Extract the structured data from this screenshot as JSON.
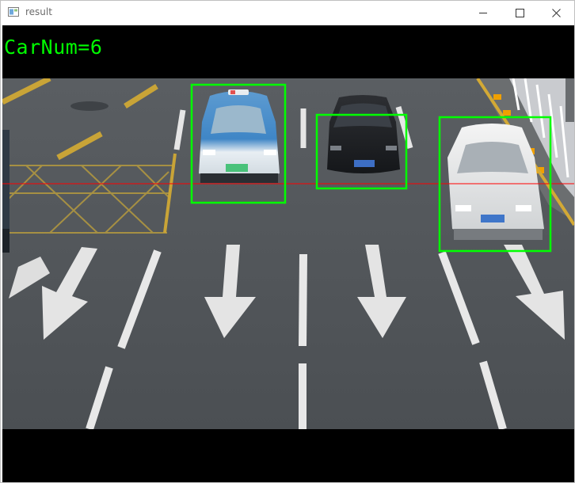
{
  "window": {
    "title": "result",
    "icons": {
      "app": "opencv-window-icon",
      "minimize": "minimize-icon",
      "maximize": "maximize-icon",
      "close": "close-icon"
    }
  },
  "overlay": {
    "car_count_text": "CarNum=6",
    "text_color": "#00ff00",
    "box_color": "#00ff00",
    "line_color": "#ff0000"
  },
  "detections": [
    {
      "label": "car",
      "vehicle": "blue-white-taxi"
    },
    {
      "label": "car",
      "vehicle": "black-sedan"
    },
    {
      "label": "car",
      "vehicle": "white-suv"
    }
  ]
}
